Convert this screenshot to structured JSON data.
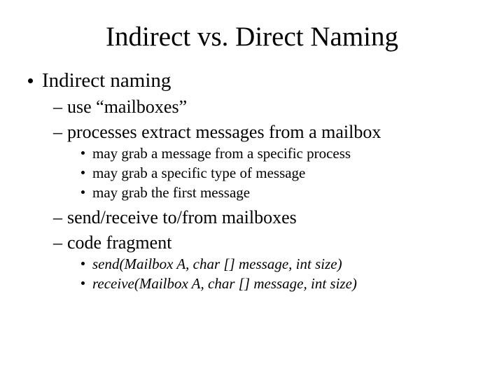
{
  "title": "Indirect vs. Direct Naming",
  "l1_0": "Indirect naming",
  "l2_0": "use “mailboxes”",
  "l2_1": "processes extract messages from a mailbox",
  "l3_0": "may grab a message from a specific process",
  "l3_1": "may grab a specific type of message",
  "l3_2": "may grab the first message",
  "l2_2": "send/receive to/from mailboxes",
  "l2_3": "code fragment",
  "l3_3": "send(Mailbox A, char [] message, int size)",
  "l3_4": "receive(Mailbox A, char [] message, int size)"
}
